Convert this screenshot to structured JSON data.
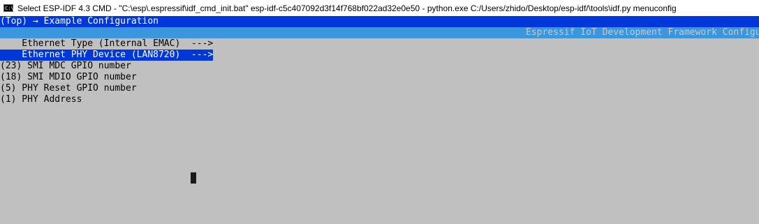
{
  "window": {
    "icon": "cmd-icon",
    "title": "Select ESP-IDF 4.3 CMD - \"C:\\esp\\.espressif\\idf_cmd_init.bat\"  esp-idf-c5c407092d3f14f768bf022ad32e0e50 - python.exe  C:/Users/zhido/Desktop/esp-idf/\\tools\\idf.py menuconfig"
  },
  "menuconfig": {
    "breadcrumb": "(Top) → Example Configuration",
    "header_title": "Espressif IoT Development Framework Configuration",
    "items": [
      {
        "label": "    Ethernet Type (Internal EMAC)  --->",
        "selected": false
      },
      {
        "label": "    Ethernet PHY Device (LAN8720)  --->",
        "selected": true
      },
      {
        "label": "(23) SMI MDC GPIO number",
        "selected": false
      },
      {
        "label": "(18) SMI MDIO GPIO number",
        "selected": false
      },
      {
        "label": "(5) PHY Reset GPIO number",
        "selected": false
      },
      {
        "label": "(1) PHY Address",
        "selected": false
      }
    ]
  }
}
